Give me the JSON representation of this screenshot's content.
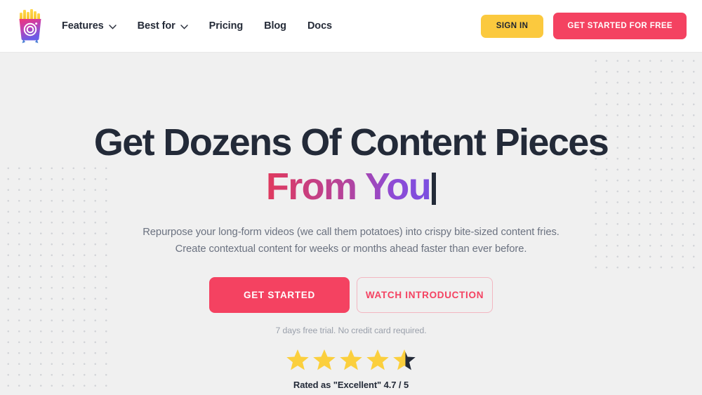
{
  "header": {
    "logo": {
      "icon": "fries-camera-logo",
      "colors": {
        "fries": "#F9C53D",
        "box_top": "#E8357F",
        "box_bottom": "#6B5CE7",
        "legs": "#4A7FD4"
      }
    },
    "nav": [
      {
        "label": "Features",
        "has_dropdown": true,
        "icon": "chevron-down-icon"
      },
      {
        "label": "Best for",
        "has_dropdown": true,
        "icon": "chevron-down-icon"
      },
      {
        "label": "Pricing",
        "has_dropdown": false
      },
      {
        "label": "Blog",
        "has_dropdown": false
      },
      {
        "label": "Docs",
        "has_dropdown": false
      }
    ],
    "sign_in_label": "SIGN IN",
    "get_started_free_label": "GET STARTED FOR FREE",
    "colors": {
      "sign_in_bg": "#FBC93E",
      "get_started_bg": "#F44261",
      "nav_text": "#252B38",
      "background": "#FFFFFF"
    }
  },
  "hero": {
    "headline_line1": "Get Dozens Of Content Pieces",
    "headline_line2": "From You",
    "headline_caret": "|",
    "subtitle": "Repurpose your long-form videos (we call them potatoes) into crispy bite-sized content fries. Create contextual content for weeks or months ahead faster than ever before.",
    "cta_primary_label": "GET STARTED",
    "cta_secondary_label": "WATCH INTRODUCTION",
    "trial_note": "7 days free trial. No credit card required.",
    "rating": {
      "label": "Rated as \"Excellent\" 4.7 / 5",
      "score": "4.7",
      "out_of": "5",
      "stars_filled": 4,
      "stars_half": 1,
      "stars_total": 5,
      "star_color": "#FBCF3D",
      "star_empty_color": "#232A38"
    },
    "colors": {
      "background": "#F0F0F0",
      "headline": "#232A38",
      "gradient_start": "#E03A5E",
      "gradient_end": "#7B4FE0",
      "subtitle": "#6B7280",
      "primary_button": "#F44261",
      "dot_pattern": "#D2D4D8"
    },
    "decor": {
      "dots_left": "dot-grid-pattern",
      "dots_right": "dot-grid-pattern"
    }
  }
}
